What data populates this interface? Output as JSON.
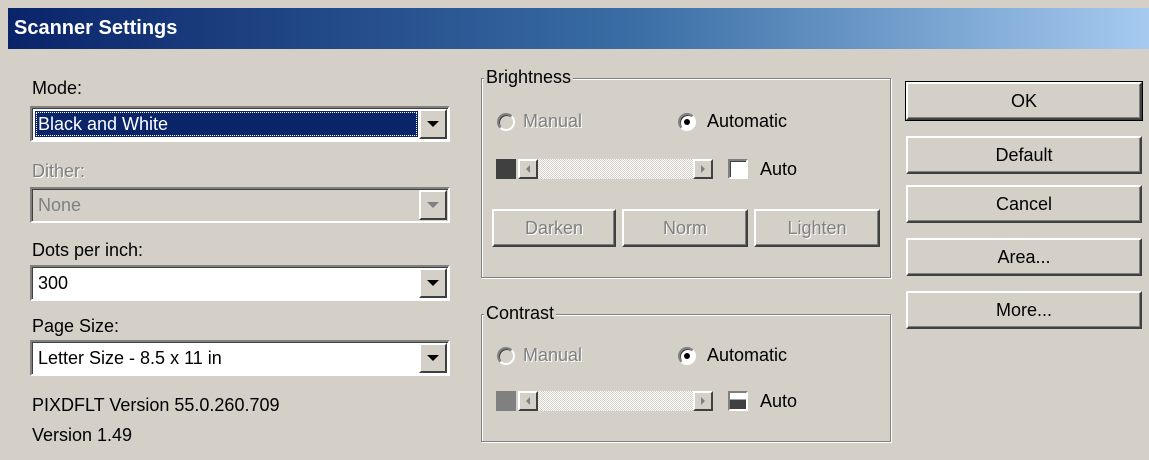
{
  "window": {
    "title": "Scanner Settings"
  },
  "left": {
    "mode_label": "Mode:",
    "mode_value": "Black and White",
    "dither_label": "Dither:",
    "dither_value": "None",
    "dpi_label": "Dots per inch:",
    "dpi_value": "300",
    "page_size_label": "Page Size:",
    "page_size_value": "Letter Size - 8.5 x 11 in",
    "pixdflt_version": "PIXDFLT Version 55.0.260.709",
    "version": "Version 1.49"
  },
  "brightness": {
    "title": "Brightness",
    "manual_label": "Manual",
    "automatic_label": "Automatic",
    "selected": "Automatic",
    "auto_label": "Auto",
    "auto_checked": false,
    "darken_label": "Darken",
    "norm_label": "Norm",
    "lighten_label": "Lighten",
    "swatch_color": "#404040"
  },
  "contrast": {
    "title": "Contrast",
    "manual_label": "Manual",
    "automatic_label": "Automatic",
    "selected": "Automatic",
    "auto_label": "Auto",
    "swatch_color": "#808080"
  },
  "buttons": {
    "ok": "OK",
    "default": "Default",
    "cancel": "Cancel",
    "area": "Area...",
    "more": "More..."
  },
  "colors": {
    "title_start": "#0a246a",
    "title_end": "#a6caf0",
    "face": "#d4d0c8",
    "selection": "#0a246a"
  }
}
